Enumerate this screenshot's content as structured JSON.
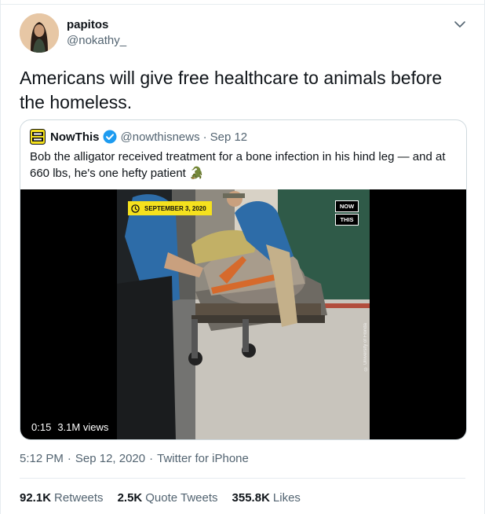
{
  "author": {
    "name": "papitos",
    "handle": "@nokathy_"
  },
  "tweet": {
    "text": "Americans will give free healthcare to animals before the homeless."
  },
  "quote": {
    "name": "NowThis",
    "handle": "@nowthisnews",
    "separator": "·",
    "date": "Sep 12",
    "text": "Bob the alligator received treatment for a bone infection in his hind leg — and at 660 lbs, he's one hefty patient 🐊",
    "video": {
      "date_overlay": "SEPTEMBER 3, 2020",
      "logo_top": "NOW",
      "logo_bottom": "THIS",
      "credit": "© University of Florida",
      "duration": "0:15",
      "views": "3.1M views"
    }
  },
  "meta": {
    "time": "5:12 PM",
    "separator": "·",
    "date": "Sep 12, 2020",
    "source": "Twitter for iPhone"
  },
  "stats": {
    "retweets_count": "92.1K",
    "retweets_label": "Retweets",
    "quotes_count": "2.5K",
    "quotes_label": "Quote Tweets",
    "likes_count": "355.8K",
    "likes_label": "Likes"
  },
  "icons": {
    "caret": "chevron-down-icon",
    "verified": "verified-badge-icon",
    "clock": "clock-icon"
  },
  "colors": {
    "secondary_text": "#536471",
    "verified_blue": "#1d9bf0",
    "badge_yellow": "#f5e11e",
    "border": "#cfd9de"
  }
}
